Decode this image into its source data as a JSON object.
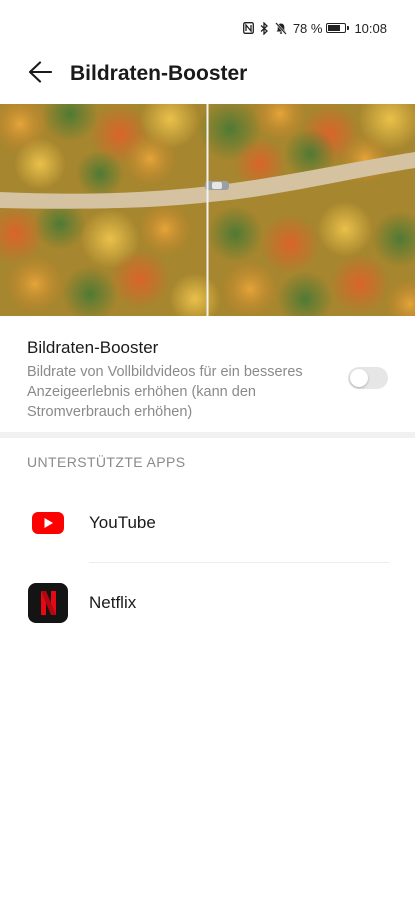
{
  "status_bar": {
    "icons": [
      "nfc-icon",
      "bluetooth-icon",
      "mute-icon"
    ],
    "battery_percent_label": "78 %",
    "battery_level": 0.78,
    "time": "10:08"
  },
  "app_bar": {
    "back_icon": "arrow-left-icon",
    "title": "Bildraten-Booster"
  },
  "hero": {
    "content": "aerial-forest-road-image"
  },
  "setting": {
    "title": "Bildraten-Booster",
    "description": "Bildrate von Vollbildvideos für ein besseres Anzeigeerlebnis erhöhen (kann den Stromverbrauch erhöhen)",
    "enabled": false
  },
  "supported_apps": {
    "header": "UNTERSTÜTZTE APPS",
    "apps": [
      {
        "name": "YouTube",
        "icon": "youtube-icon",
        "color": "#ff0000"
      },
      {
        "name": "Netflix",
        "icon": "netflix-icon",
        "color": "#e50914"
      }
    ]
  }
}
